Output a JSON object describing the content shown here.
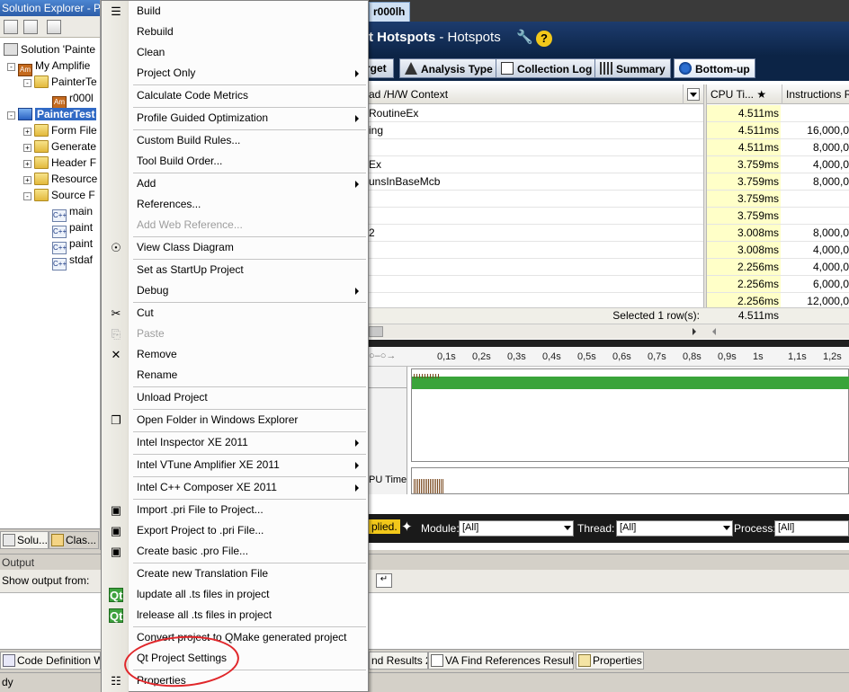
{
  "solution_explorer": {
    "title": "Solution Explorer - Pa",
    "tree": [
      {
        "label": "Solution 'Painte",
        "icon": "solution-icon",
        "level": 0
      },
      {
        "label": "My Amplifie",
        "icon": "amplifier-icon",
        "level": 1
      },
      {
        "label": "PainterTe",
        "icon": "folder-icon",
        "level": 2
      },
      {
        "label": "r000l",
        "icon": "amplifier-result-icon",
        "level": 3
      },
      {
        "label": "PainterTest",
        "icon": "project-icon",
        "level": 1,
        "selected": true
      },
      {
        "label": "Form File",
        "icon": "folder-icon",
        "level": 2
      },
      {
        "label": "Generate",
        "icon": "folder-icon",
        "level": 2
      },
      {
        "label": "Header F",
        "icon": "folder-icon",
        "level": 2
      },
      {
        "label": "Resource",
        "icon": "folder-icon",
        "level": 2
      },
      {
        "label": "Source F",
        "icon": "folder-icon",
        "level": 2
      },
      {
        "label": "main",
        "icon": "cpp-file-icon",
        "level": 3
      },
      {
        "label": "paint",
        "icon": "cpp-file-icon",
        "level": 3
      },
      {
        "label": "paint",
        "icon": "cpp-file-icon",
        "level": 3
      },
      {
        "label": "stdaf",
        "icon": "cpp-file-icon",
        "level": 3
      }
    ],
    "tabs": [
      "Solu...",
      "Clas..."
    ]
  },
  "context_menu": [
    {
      "label": "Build",
      "icon": "build-icon"
    },
    {
      "label": "Rebuild"
    },
    {
      "label": "Clean"
    },
    {
      "label": "Project Only",
      "submenu": true
    },
    {
      "sep": true
    },
    {
      "label": "Calculate Code Metrics"
    },
    {
      "sep": true
    },
    {
      "label": "Profile Guided Optimization",
      "submenu": true
    },
    {
      "sep": true
    },
    {
      "label": "Custom Build Rules..."
    },
    {
      "label": "Tool Build Order..."
    },
    {
      "sep": true
    },
    {
      "label": "Add",
      "submenu": true
    },
    {
      "label": "References..."
    },
    {
      "label": "Add Web Reference...",
      "disabled": true
    },
    {
      "sep": true
    },
    {
      "label": "View Class Diagram",
      "icon": "class-diagram-icon"
    },
    {
      "sep": true
    },
    {
      "label": "Set as StartUp Project"
    },
    {
      "label": "Debug",
      "submenu": true
    },
    {
      "sep": true
    },
    {
      "label": "Cut",
      "icon": "scissors-icon"
    },
    {
      "label": "Paste",
      "icon": "paste-icon",
      "disabled": true
    },
    {
      "label": "Remove",
      "icon": "remove-icon"
    },
    {
      "label": "Rename"
    },
    {
      "sep": true
    },
    {
      "label": "Unload Project"
    },
    {
      "sep": true
    },
    {
      "label": "Open Folder in Windows Explorer",
      "icon": "open-folder-icon"
    },
    {
      "sep": true
    },
    {
      "label": "Intel Inspector XE 2011",
      "submenu": true
    },
    {
      "sep": true
    },
    {
      "label": "Intel VTune Amplifier XE 2011",
      "submenu": true
    },
    {
      "sep": true
    },
    {
      "label": "Intel C++ Composer XE 2011",
      "submenu": true
    },
    {
      "sep": true
    },
    {
      "label": "Import .pri File to Project...",
      "icon": "import-pri-icon"
    },
    {
      "label": "Export Project to .pri File...",
      "icon": "export-pri-icon"
    },
    {
      "label": "Create basic .pro File...",
      "icon": "create-pro-icon"
    },
    {
      "sep": true
    },
    {
      "label": "Create new Translation File"
    },
    {
      "label": "lupdate all .ts files in project",
      "icon": "qt-icon"
    },
    {
      "label": "lrelease all .ts files in project",
      "icon": "qt-icon"
    },
    {
      "sep": true
    },
    {
      "label": "Convert project to QMake generated project"
    },
    {
      "label": "Qt Project Settings"
    },
    {
      "sep": true
    },
    {
      "label": "Properties",
      "icon": "properties-icon"
    }
  ],
  "vtune": {
    "tab": "r000lh",
    "header_bold": "t Hotspots",
    "header_rest": " - Hotspots",
    "toolbar": {
      "target": "rget",
      "analysis_type": "Analysis Type",
      "collection_log": "Collection Log",
      "summary": "Summary",
      "bottom_up": "Bottom-up"
    },
    "grid": {
      "col0": "ad /H/W Context",
      "col1": "CPU Ti...",
      "col2": "Instructions R",
      "rows": [
        {
          "name": "RoutineEx",
          "cpu": "4.511ms",
          "instr": ""
        },
        {
          "name": "ing",
          "cpu": "4.511ms",
          "instr": "16,000,0"
        },
        {
          "name": "",
          "cpu": "4.511ms",
          "instr": "8,000,0"
        },
        {
          "name": "Ex",
          "cpu": "3.759ms",
          "instr": "4,000,0"
        },
        {
          "name": "unsInBaseMcb",
          "cpu": "3.759ms",
          "instr": "8,000,0"
        },
        {
          "name": "",
          "cpu": "3.759ms",
          "instr": ""
        },
        {
          "name": "",
          "cpu": "3.759ms",
          "instr": ""
        },
        {
          "name": "2",
          "cpu": "3.008ms",
          "instr": "8,000,0"
        },
        {
          "name": "",
          "cpu": "3.008ms",
          "instr": "4,000,0"
        },
        {
          "name": "",
          "cpu": "2.256ms",
          "instr": "4,000,0"
        },
        {
          "name": "",
          "cpu": "2.256ms",
          "instr": "6,000,0"
        },
        {
          "name": "",
          "cpu": "2.256ms",
          "instr": "12,000,0"
        }
      ],
      "selected_text": "Selected 1 row(s):",
      "selected_cpu": "4.511ms"
    },
    "timeline_ticks": [
      "0,1s",
      "0,2s",
      "0,3s",
      "0,4s",
      "0,5s",
      "0,6s",
      "0,7s",
      "0,8s",
      "0,9s",
      "1s",
      "1,1s",
      "1,2s"
    ],
    "cpu_time_label": "PU Time",
    "filter": {
      "applied": "plied.",
      "module_label": "Module:",
      "module_value": "[All]",
      "thread_label": "Thread:",
      "thread_value": "[All]",
      "process_label": "Process:",
      "process_value": "[All]"
    }
  },
  "output": {
    "title": "Output",
    "show_output_from": "Show output from:"
  },
  "bottom_tabs": [
    "Code Definition W",
    "nd Results 2",
    "VA Find References Results",
    "Properties"
  ],
  "status": "dy"
}
